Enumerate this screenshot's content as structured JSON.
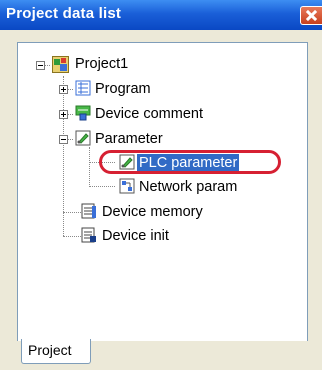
{
  "window": {
    "title": "Project data list"
  },
  "tree": {
    "root": "Project1",
    "program": "Program",
    "device_comment": "Device comment",
    "parameter": "Parameter",
    "plc_parameter": "PLC parameter",
    "network_param": "Network param",
    "device_memory": "Device memory",
    "device_init": "Device init"
  },
  "tabs": {
    "project": "Project"
  },
  "colors": {
    "title_bar": "#1a5fd8",
    "selection": "#316ac5",
    "highlight_ring": "#d62032"
  }
}
